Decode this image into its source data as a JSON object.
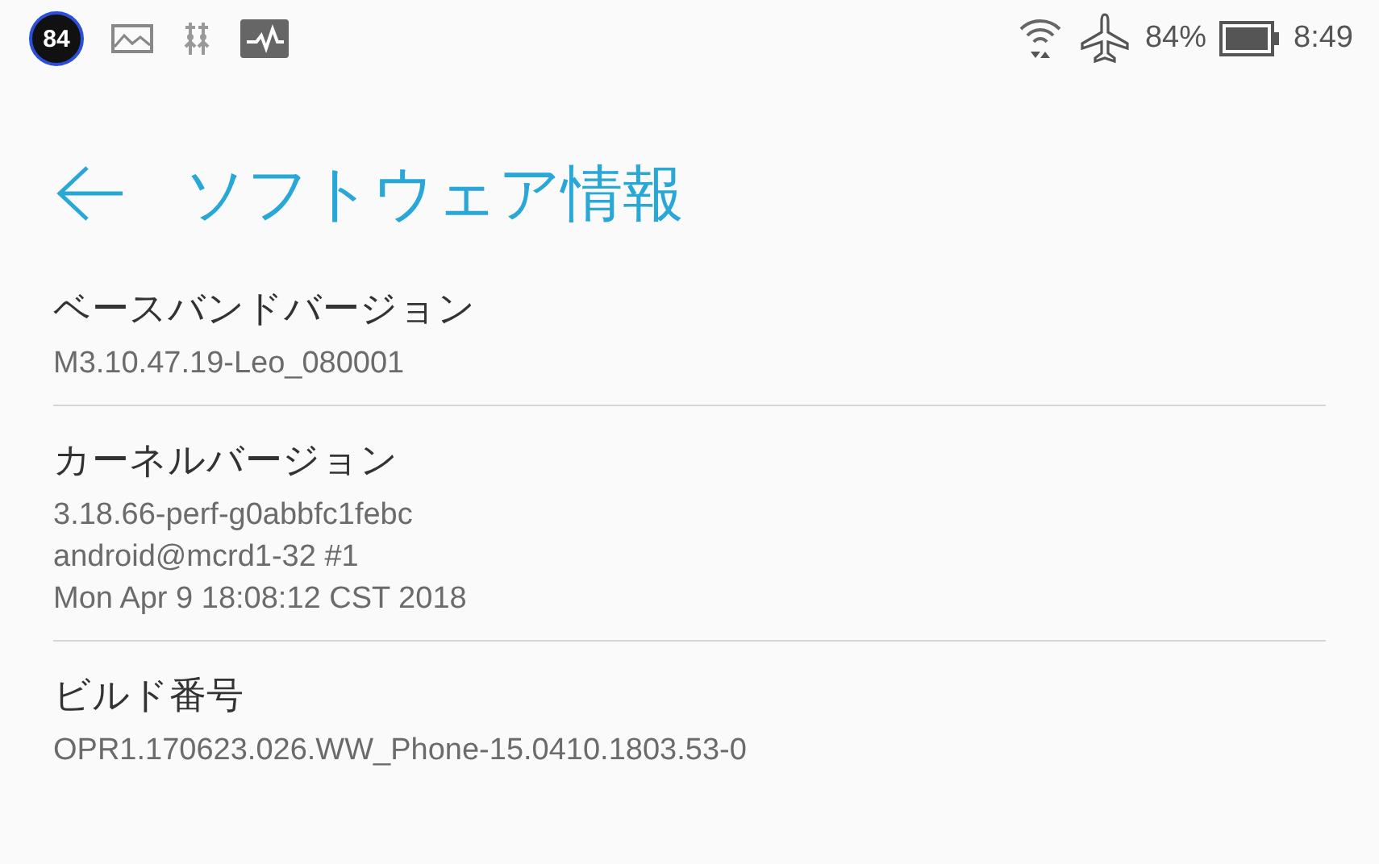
{
  "status_bar": {
    "badge": "84",
    "battery": "84%",
    "time": "8:49"
  },
  "header": {
    "title": "ソフトウェア情報"
  },
  "items": [
    {
      "label": "ベースバンドバージョン",
      "lines": [
        "M3.10.47.19-Leo_080001"
      ]
    },
    {
      "label": "カーネルバージョン",
      "lines": [
        "3.18.66-perf-g0abbfc1febc",
        "android@mcrd1-32 #1",
        "Mon Apr 9 18:08:12 CST 2018"
      ]
    },
    {
      "label": "ビルド番号",
      "lines": [
        "OPR1.170623.026.WW_Phone-15.0410.1803.53-0"
      ]
    }
  ]
}
